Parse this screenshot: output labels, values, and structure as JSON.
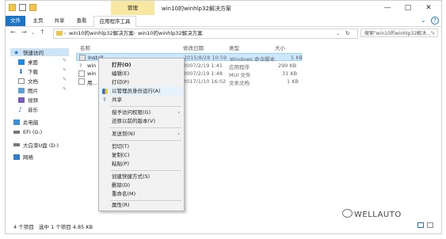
{
  "window": {
    "context_tab": "管理",
    "title": "win10的winhlp32解决方案",
    "controls": {
      "minimize": "—",
      "maximize": "□",
      "close": "✕"
    }
  },
  "ribbon": {
    "tabs": [
      "文件",
      "主页",
      "共享",
      "查看",
      "应用程序工具"
    ],
    "help": "?"
  },
  "address": {
    "back": "←",
    "forward": "→",
    "up": "↑",
    "path": [
      "win10的winhlp32解决方案",
      "win10的winhlp32解决方案"
    ],
    "refresh": "↻",
    "search_placeholder": "搜索\"win10的winhlp32解决...\""
  },
  "sidebar": {
    "items": [
      {
        "label": "快速访问",
        "icon": "star-icon"
      },
      {
        "label": "桌面",
        "icon": "desktop-icon"
      },
      {
        "label": "下载",
        "icon": "download-icon"
      },
      {
        "label": "文档",
        "icon": "document-icon"
      },
      {
        "label": "图片",
        "icon": "picture-icon"
      },
      {
        "label": "视频",
        "icon": "video-icon"
      },
      {
        "label": "音乐",
        "icon": "music-icon"
      },
      {
        "label": "此电脑",
        "icon": "computer-icon"
      },
      {
        "label": "EFI (G:)",
        "icon": "drive-icon"
      },
      {
        "label": "大白菜U盘 (D:)",
        "icon": "usb-drive-icon"
      },
      {
        "label": "网络",
        "icon": "network-icon"
      }
    ]
  },
  "columns": {
    "name": "名称",
    "date": "修改日期",
    "type": "类型",
    "size": "大小"
  },
  "files": [
    {
      "name": "Install",
      "date": "2015/8/28 10:59",
      "type": "Windows 命令脚本",
      "size": "5 KB"
    },
    {
      "name": "win",
      "date": "2007/2/19 1:41",
      "type": "应用程序",
      "size": "290 KB"
    },
    {
      "name": "win",
      "date": "2007/2/19 1:48",
      "type": "MUI 文件",
      "size": "31 KB"
    },
    {
      "name": "用…",
      "date": "2017/1/10 16:02",
      "type": "文本文档",
      "size": "1 KB"
    }
  ],
  "context_menu": {
    "items": [
      {
        "label": "打开(O)",
        "bold": true
      },
      {
        "label": "编辑(E)"
      },
      {
        "label": "打印(P)"
      },
      {
        "label": "以管理员身份运行(A)",
        "highlighted": true
      },
      {
        "label": "共享"
      },
      {
        "label": "授予访问权限(G)",
        "submenu": true
      },
      {
        "label": "还原以前的版本(V)"
      },
      {
        "label": "发送到(N)",
        "submenu": true
      },
      {
        "label": "剪切(T)"
      },
      {
        "label": "复制(C)"
      },
      {
        "label": "粘贴(P)"
      },
      {
        "label": "创建快捷方式(S)"
      },
      {
        "label": "删除(D)"
      },
      {
        "label": "重命名(M)"
      },
      {
        "label": "属性(R)"
      }
    ]
  },
  "status": {
    "count": "4 个项目",
    "selected": "选中 1 个项目 4.85 KB"
  },
  "watermark": "WELLAUTO"
}
